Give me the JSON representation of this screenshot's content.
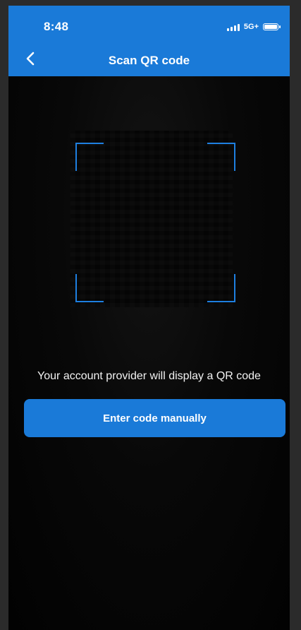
{
  "status_bar": {
    "time": "8:48",
    "network": "5G+",
    "icons": [
      "signal-icon",
      "battery-icon"
    ]
  },
  "header": {
    "title": "Scan QR code",
    "back_icon": "chevron-left-icon",
    "color": "#1a7ad8"
  },
  "scanner": {
    "frame_color": "#1e7fe0",
    "hint": "Your account provider will display a QR code"
  },
  "actions": {
    "manual_entry_label": "Enter code manually"
  }
}
